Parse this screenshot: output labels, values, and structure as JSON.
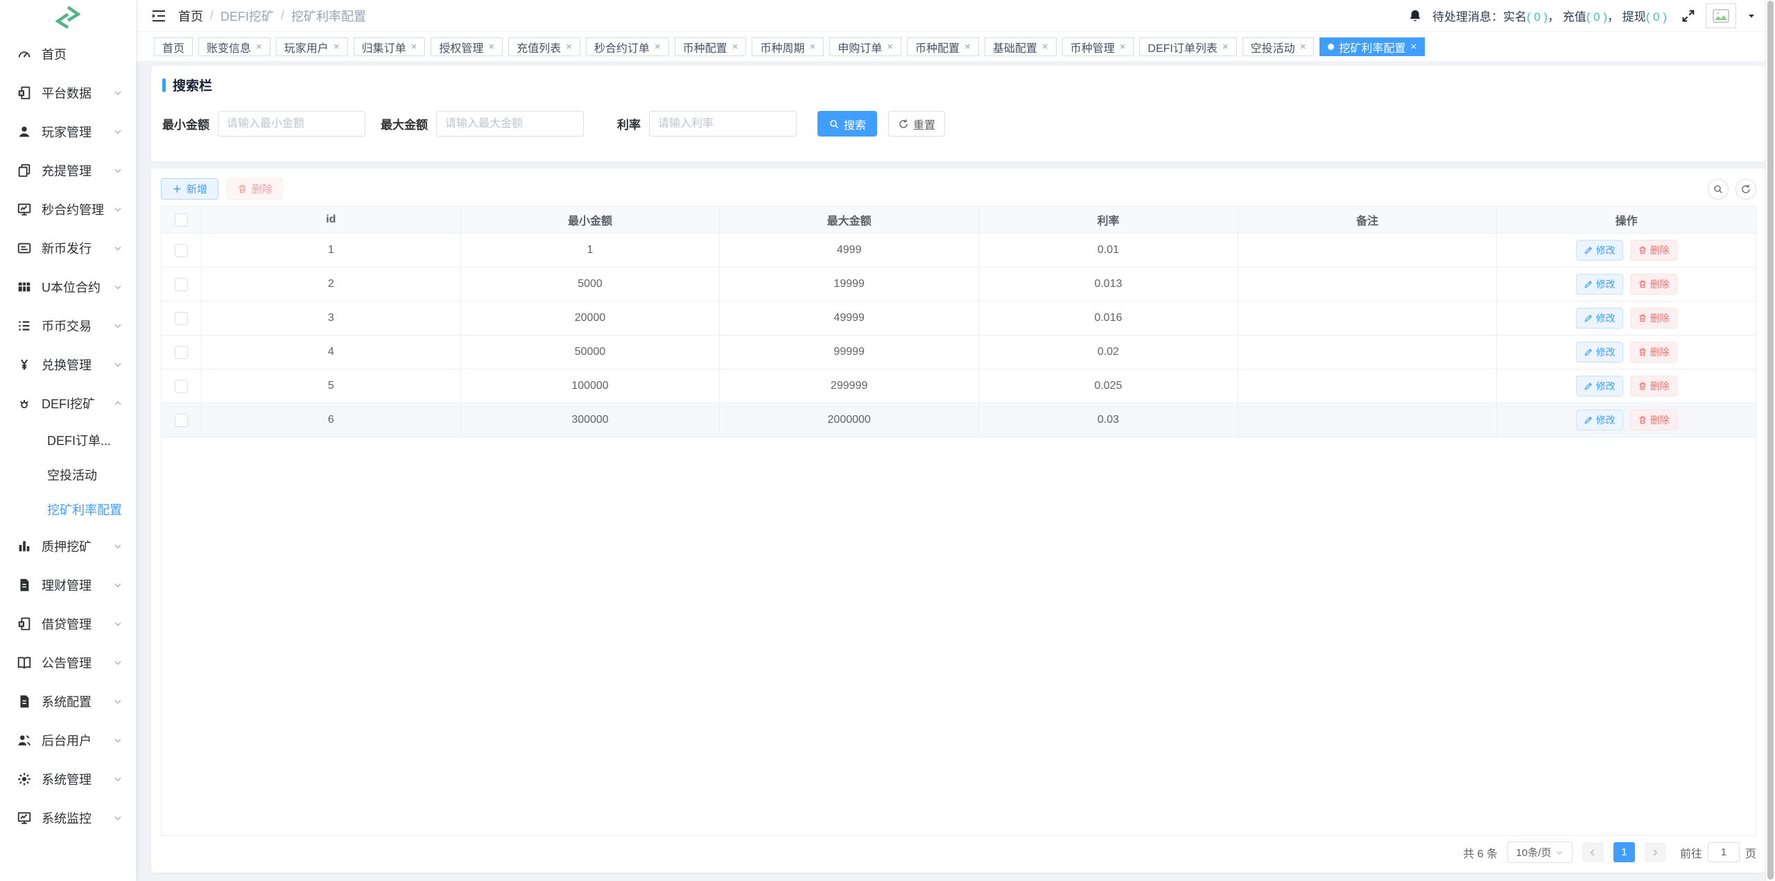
{
  "colors": {
    "primary": "#409EFF",
    "success_teal": "#3bc7ab",
    "danger": "#F56C6C",
    "logo_green": "#4FB786"
  },
  "sidebar": {
    "items": [
      {
        "icon": "dashboard-icon",
        "label": "首页",
        "collapsible": false
      },
      {
        "icon": "platform-data-icon",
        "label": "平台数据",
        "collapsible": true
      },
      {
        "icon": "players-icon",
        "label": "玩家管理",
        "collapsible": true
      },
      {
        "icon": "deposit-withdraw-icon",
        "label": "充提管理",
        "collapsible": true
      },
      {
        "icon": "seconds-contract-icon",
        "label": "秒合约管理",
        "collapsible": true
      },
      {
        "icon": "newcoin-icon",
        "label": "新币发行",
        "collapsible": true
      },
      {
        "icon": "usdt-contract-icon",
        "label": "U本位合约",
        "collapsible": true
      },
      {
        "icon": "coin-trade-icon",
        "label": "币币交易",
        "collapsible": true
      },
      {
        "icon": "exchange-icon",
        "label": "兑换管理",
        "collapsible": true
      },
      {
        "icon": "defi-mining-icon",
        "label": "DEFI挖矿",
        "collapsible": true,
        "expanded": true,
        "children": [
          {
            "label": "DEFI订单...",
            "active": false
          },
          {
            "label": "空投活动",
            "active": false
          },
          {
            "label": "挖矿利率配置",
            "active": true
          }
        ]
      },
      {
        "icon": "stake-mining-icon",
        "label": "质押挖矿",
        "collapsible": true
      },
      {
        "icon": "finance-icon",
        "label": "理财管理",
        "collapsible": true
      },
      {
        "icon": "loan-icon",
        "label": "借贷管理",
        "collapsible": true
      },
      {
        "icon": "notice-icon",
        "label": "公告管理",
        "collapsible": true
      },
      {
        "icon": "sysconfig-icon",
        "label": "系统配置",
        "collapsible": true
      },
      {
        "icon": "admin-users-icon",
        "label": "后台用户",
        "collapsible": true
      },
      {
        "icon": "sysmanage-icon",
        "label": "系统管理",
        "collapsible": true
      },
      {
        "icon": "sysmonitor-icon",
        "label": "系统监控",
        "collapsible": true
      }
    ]
  },
  "navbar": {
    "breadcrumb": [
      "首页",
      "DEFI挖矿",
      "挖矿利率配置"
    ],
    "separator": "/",
    "notice": {
      "prefix": "待处理消息：",
      "segments": [
        {
          "label": "实名",
          "count": "( 0 )"
        },
        {
          "label": "充值",
          "count": "( 0 )"
        },
        {
          "label": "提现",
          "count": "( 0 )"
        }
      ],
      "separator": "，"
    }
  },
  "tabs": [
    {
      "label": "首页",
      "closable": false,
      "active": false
    },
    {
      "label": "账变信息",
      "closable": true,
      "active": false
    },
    {
      "label": "玩家用户",
      "closable": true,
      "active": false
    },
    {
      "label": "归集订单",
      "closable": true,
      "active": false
    },
    {
      "label": "授权管理",
      "closable": true,
      "active": false
    },
    {
      "label": "充值列表",
      "closable": true,
      "active": false
    },
    {
      "label": "秒合约订单",
      "closable": true,
      "active": false
    },
    {
      "label": "币种配置",
      "closable": true,
      "active": false
    },
    {
      "label": "币种周期",
      "closable": true,
      "active": false
    },
    {
      "label": "申购订单",
      "closable": true,
      "active": false
    },
    {
      "label": "币种配置",
      "closable": true,
      "active": false
    },
    {
      "label": "基础配置",
      "closable": true,
      "active": false
    },
    {
      "label": "币种管理",
      "closable": true,
      "active": false
    },
    {
      "label": "DEFI订单列表",
      "closable": true,
      "active": false
    },
    {
      "label": "空投活动",
      "closable": true,
      "active": false
    },
    {
      "label": "挖矿利率配置",
      "closable": true,
      "active": true
    }
  ],
  "search": {
    "title": "搜索栏",
    "fields": [
      {
        "label": "最小金额",
        "placeholder": "请输入最小金额"
      },
      {
        "label": "最大金额",
        "placeholder": "请输入最大金额"
      },
      {
        "label": "利率",
        "placeholder": "请输入利率"
      }
    ],
    "search_label": "搜索",
    "reset_label": "重置"
  },
  "toolbar": {
    "add_label": "新增",
    "delete_label": "删除"
  },
  "table": {
    "columns": [
      "id",
      "最小金额",
      "最大金额",
      "利率",
      "备注",
      "操作"
    ],
    "edit_label": "修改",
    "delete_label": "删除",
    "rows": [
      {
        "cells": [
          "1",
          "1",
          "4999",
          "0.01",
          ""
        ],
        "highlighted": false
      },
      {
        "cells": [
          "2",
          "5000",
          "19999",
          "0.013",
          ""
        ],
        "highlighted": false
      },
      {
        "cells": [
          "3",
          "20000",
          "49999",
          "0.016",
          ""
        ],
        "highlighted": false
      },
      {
        "cells": [
          "4",
          "50000",
          "99999",
          "0.02",
          ""
        ],
        "highlighted": false
      },
      {
        "cells": [
          "5",
          "100000",
          "299999",
          "0.025",
          ""
        ],
        "highlighted": false
      },
      {
        "cells": [
          "6",
          "300000",
          "2000000",
          "0.03",
          ""
        ],
        "highlighted": true
      }
    ]
  },
  "pagination": {
    "total_label": "共 6 条",
    "page_size_label": "10条/页",
    "current_page": "1",
    "goto_label": "前往",
    "goto_value": "1",
    "unit_label": "页"
  }
}
